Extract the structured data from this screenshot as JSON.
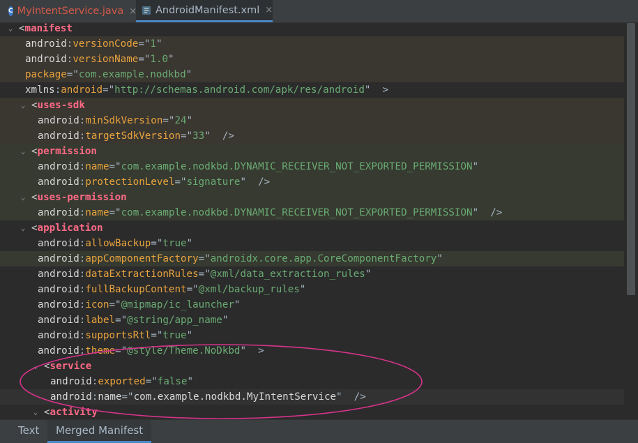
{
  "tabs": [
    {
      "label": "MyIntentService.java",
      "icon": "java-class-icon",
      "icon_letter": "C",
      "close": "×"
    },
    {
      "label": "AndroidManifest.xml",
      "icon": "xml-file-icon",
      "close": "×"
    }
  ],
  "bottom_tabs": [
    {
      "label": "Text"
    },
    {
      "label": "Merged Manifest"
    }
  ],
  "lines": [
    {
      "type": "tag",
      "fold": "⌄",
      "prefix": "<",
      "tag": "manifest",
      "indent": 0
    },
    {
      "type": "attr",
      "ns": "android",
      "attr": "versionCode",
      "value": "1",
      "indent": 1,
      "hl": "brown"
    },
    {
      "type": "attr",
      "ns": "android",
      "attr": "versionName",
      "value": "1.0",
      "indent": 1,
      "hl": "brown"
    },
    {
      "type": "attr",
      "ns": "",
      "attr": "package",
      "value": "com.example.nodkbd",
      "indent": 1,
      "hl": "brown"
    },
    {
      "type": "xmlns",
      "ns": "xmlns",
      "attr": "android",
      "value": "http://schemas.android.com/apk/res/android",
      "end": ">",
      "indent": 1
    },
    {
      "type": "tag",
      "fold": "⌄",
      "prefix": "<",
      "tag": "uses-sdk",
      "indent": 1,
      "hl": "brown"
    },
    {
      "type": "attr",
      "ns": "android",
      "attr": "minSdkVersion",
      "value": "24",
      "indent": 2,
      "hl": "brown"
    },
    {
      "type": "attr",
      "ns": "android",
      "attr": "targetSdkVersion",
      "value": "33",
      "end": "/>",
      "indent": 2,
      "hl": "brown"
    },
    {
      "type": "tag",
      "fold": "⌄",
      "prefix": "<",
      "tag": "permission",
      "indent": 1,
      "hl": "olive"
    },
    {
      "type": "attr",
      "ns": "android",
      "attr": "name",
      "value": "com.example.nodkbd.DYNAMIC_RECEIVER_NOT_EXPORTED_PERMISSION",
      "indent": 2,
      "hl": "olive"
    },
    {
      "type": "attr",
      "ns": "android",
      "attr": "protectionLevel",
      "value": "signature",
      "end": "/>",
      "indent": 2,
      "hl": "olive"
    },
    {
      "type": "tag",
      "fold": "⌄",
      "prefix": "<",
      "tag": "uses-permission",
      "indent": 1,
      "hl": "olive"
    },
    {
      "type": "attr",
      "ns": "android",
      "attr": "name",
      "value": "com.example.nodkbd.DYNAMIC_RECEIVER_NOT_EXPORTED_PERMISSION",
      "end": "/>",
      "indent": 2,
      "hl": "olive"
    },
    {
      "type": "tag",
      "fold": "⌄",
      "prefix": "<",
      "tag": "application",
      "indent": 1
    },
    {
      "type": "attr",
      "ns": "android",
      "attr": "allowBackup",
      "value": "true",
      "indent": 2
    },
    {
      "type": "attr",
      "ns": "android",
      "attr": "appComponentFactory",
      "value": "androidx.core.app.CoreComponentFactory",
      "indent": 2,
      "hl": "olive"
    },
    {
      "type": "attr",
      "ns": "android",
      "attr": "dataExtractionRules",
      "value": "@xml/data_extraction_rules",
      "indent": 2
    },
    {
      "type": "attr",
      "ns": "android",
      "attr": "fullBackupContent",
      "value": "@xml/backup_rules",
      "indent": 2
    },
    {
      "type": "attr",
      "ns": "android",
      "attr": "icon",
      "value": "@mipmap/ic_launcher",
      "indent": 2
    },
    {
      "type": "attr",
      "ns": "android",
      "attr": "label",
      "value": "@string/app_name",
      "indent": 2
    },
    {
      "type": "attr",
      "ns": "android",
      "attr": "supportsRtl",
      "value": "true",
      "indent": 2
    },
    {
      "type": "attr",
      "ns": "android",
      "attr": "theme",
      "value": "@style/Theme.NoDkbd",
      "end": ">",
      "indent": 2
    },
    {
      "type": "tag",
      "fold": "⌄",
      "prefix": "<",
      "tag": "service",
      "indent": 2
    },
    {
      "type": "attr",
      "ns": "android",
      "attr": "exported",
      "value": "false",
      "indent": 3
    },
    {
      "type": "plainattr",
      "ns": "android",
      "attr": "name",
      "value": "com.example.nodkbd.MyIntentService",
      "end": "/>",
      "indent": 3,
      "hl": "cur"
    },
    {
      "type": "tag",
      "fold": "⌄",
      "prefix": "<",
      "tag": "activity",
      "indent": 2
    }
  ],
  "colors": {
    "annotation_ellipse": "#d6338a",
    "tag_name": "#ff6a86",
    "attribute_name": "#e8a33e",
    "attribute_value": "#6aab73",
    "active_tab_underline": "#4a88c7"
  }
}
